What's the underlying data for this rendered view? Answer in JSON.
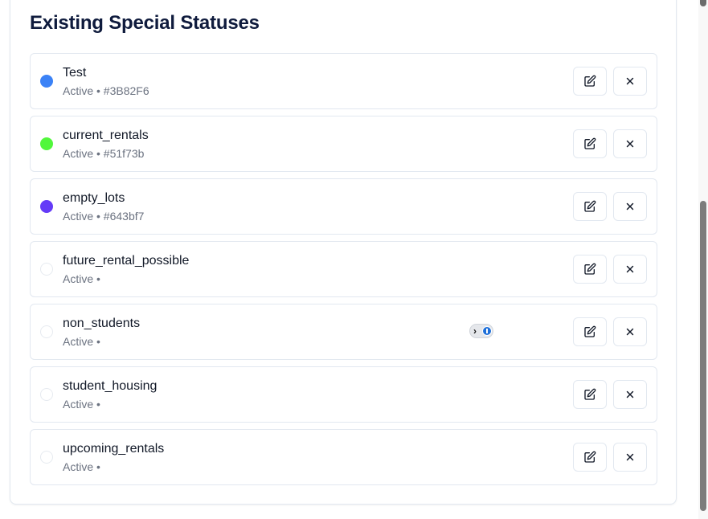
{
  "section": {
    "title": "Existing Special Statuses"
  },
  "statuses": [
    {
      "name": "Test",
      "meta": "Active • #3B82F6",
      "color": "#3B82F6"
    },
    {
      "name": "current_rentals",
      "meta": "Active • #51f73b",
      "color": "#51f73b"
    },
    {
      "name": "empty_lots",
      "meta": "Active • #643bf7",
      "color": "#643bf7"
    },
    {
      "name": "future_rental_possible",
      "meta": "Active •",
      "color": ""
    },
    {
      "name": "non_students",
      "meta": "Active •",
      "color": ""
    },
    {
      "name": "student_housing",
      "meta": "Active •",
      "color": ""
    },
    {
      "name": "upcoming_rentals",
      "meta": "Active •",
      "color": ""
    }
  ],
  "icons": {
    "edit": "edit-icon",
    "delete": "close-icon",
    "password_manager": "password-manager-icon"
  }
}
